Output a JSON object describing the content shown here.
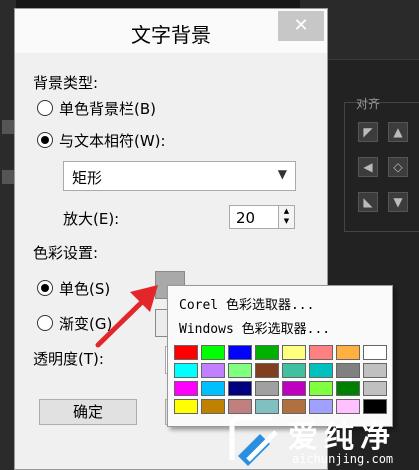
{
  "dialog": {
    "title": "文字背景",
    "close_glyph": "✕",
    "background_type_label": "背景类型:",
    "solid_bar_label": "单色背景栏(B)",
    "match_text_label": "与文本相符(W):",
    "shape_value": "矩形",
    "enlarge_label": "放大(E):",
    "enlarge_value": "20",
    "color_settings_label": "色彩设置:",
    "single_color_label": "单色(S)",
    "gradient_label": "渐变(G)",
    "opacity_label": "透明度(T):",
    "ok_label": "确定",
    "selected_background_type": "match_text",
    "selected_color_mode": "single",
    "single_color_swatch": "#a9a9a9"
  },
  "color_popup": {
    "corel_picker": "Corel 色彩选取器...",
    "windows_picker": "Windows 色彩选取器...",
    "palette": [
      "#ff0000",
      "#00ff00",
      "#0000ff",
      "#00b000",
      "#ffff80",
      "#ff8080",
      "#ffb040",
      "#ffffff",
      "#00ffff",
      "#c080ff",
      "#80ff80",
      "#804020",
      "#40c0a0",
      "#00c0c0",
      "#808080",
      "#c0c0c0",
      "#ff00ff",
      "#00c0ff",
      "#000080",
      "#a0a0a0",
      "#c000c0",
      "#80ff40",
      "#008000",
      "#c0c0c0",
      "#ffff00",
      "#c08000",
      "#c08080",
      "#80c0c0",
      "#b07040",
      "#a0a0ff",
      "#ffc0ff",
      "#000000"
    ]
  },
  "editor_panel": {
    "align_label": "对齐"
  },
  "watermark": {
    "brand_text": "爱纯净",
    "url_text": "aichunjing.com"
  },
  "colors": {
    "pointer_red": "#e3262a",
    "close_button_gray": "#c7c7c7",
    "dialog_bg": "#f0f0f0"
  },
  "icons": {
    "close": "close-icon",
    "dropdown": "chevron-down-icon",
    "spinner": "spinner-arrows-icon",
    "pointer": "red-arrow-pointer-icon",
    "logo": "aichunjing-logo-icon"
  }
}
